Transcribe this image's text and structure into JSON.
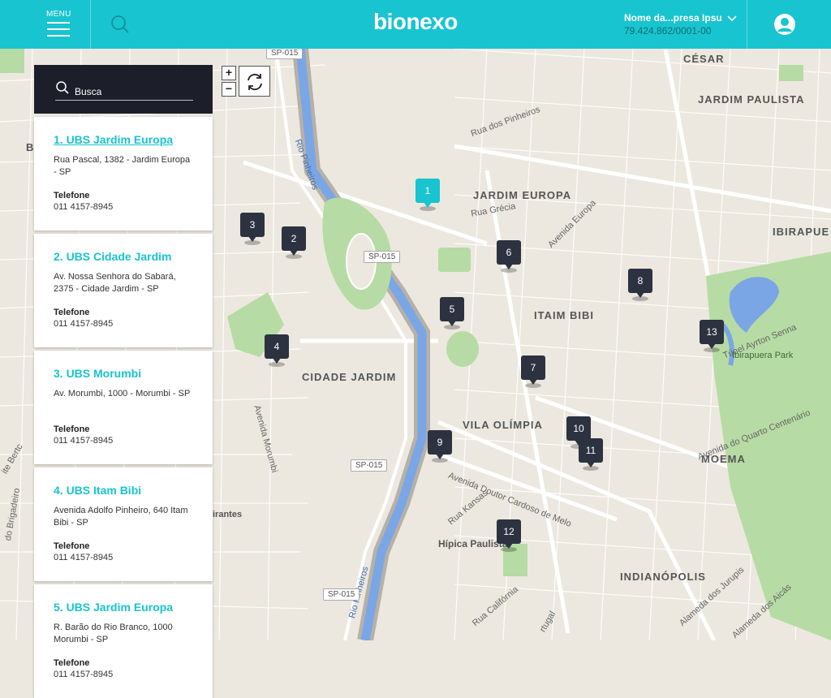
{
  "header": {
    "menu_label": "MENU",
    "logo": "bionexo",
    "company_name": "Nome da...presa Ipsu",
    "company_cnpj": "79.424.862/0001-00"
  },
  "search": {
    "placeholder": "Busca"
  },
  "list": [
    {
      "title": "1. UBS Jardim Europa",
      "address": "Rua Pascal, 1382 - Jardim Europa - SP",
      "phone_label": "Telefone",
      "phone": "011 4157-8945"
    },
    {
      "title": "2. UBS Cidade Jardim",
      "address": "Av. Nossa Senhora do Sabará, 2375 - Cidade Jardim - SP",
      "phone_label": "Telefone",
      "phone": "011 4157-8945"
    },
    {
      "title": "3. UBS Morumbi",
      "address": "Av. Morumbi, 1000 - Morumbi - SP",
      "phone_label": "Telefone",
      "phone": "011 4157-8945"
    },
    {
      "title": "4. UBS Itam Bibi",
      "address": "Avenida Adolfo Pinheiro, 640 Itam Bibi - SP",
      "phone_label": "Telefone",
      "phone": "011 4157-8945"
    },
    {
      "title": "5. UBS Jardim Europa",
      "address": "R. Barão do Rio Branco, 1000 Morumbi - SP",
      "phone_label": "Telefone",
      "phone": "011 4157-8945"
    }
  ],
  "map": {
    "zoom_in": "+",
    "zoom_out": "−",
    "markers": [
      "1",
      "2",
      "3",
      "4",
      "5",
      "6",
      "7",
      "8",
      "9",
      "10",
      "11",
      "12",
      "13"
    ],
    "areas": [
      "CÉSAR",
      "JARDIM PAULISTA",
      "JARDIM EUROPA",
      "IBIRAPUE",
      "ITAIM BIBI",
      "CIDADE JARDIM",
      "VILA OLÍMPIA",
      "MOEMA",
      "INDIANÓPOLIS",
      "Hípica Paulista",
      "Ibirapuera Park",
      "B",
      "ite Bertc",
      "do Brigadeiro",
      "irantes"
    ],
    "roads": [
      "Rua dos Pinheiros",
      "Rua Grécia",
      "Avenida Europa",
      "Túnel Ayrton Senna",
      "Avenida do Quarto Centenário",
      "Avenida Morumbi",
      "Avenida Doutor Cardoso de Melo",
      "Rua Kansas",
      "Rua Califórnia",
      "Alameda dos Jurupis",
      "Alameda dos Aicás",
      "Rio Pinheiros",
      "Rio Pinheiros",
      "rtugal"
    ],
    "highways": [
      "SP-015",
      "SP-015",
      "SP-015",
      "SP-015"
    ]
  },
  "colors": {
    "accent": "#18c4cf",
    "panel_dark": "#1c1f2a",
    "marker": "#2c3240",
    "park": "#b7dba4",
    "water": "#7aa6e6"
  }
}
